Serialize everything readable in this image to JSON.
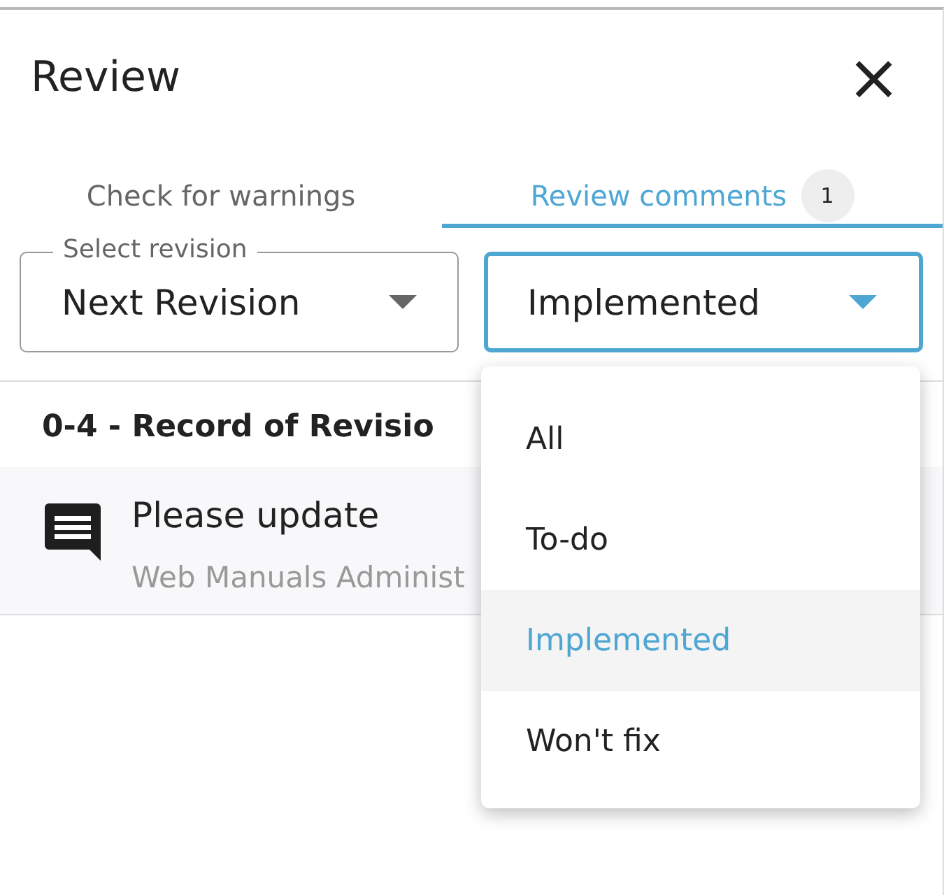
{
  "panel": {
    "title": "Review",
    "close": "×"
  },
  "tabs": [
    {
      "label": "Check for warnings",
      "selected": false
    },
    {
      "label": "Review comments",
      "selected": true,
      "badge": "1"
    }
  ],
  "revision_select": {
    "label": "Select revision",
    "value": "Next Revision"
  },
  "status_select": {
    "value": "Implemented",
    "expanded": true,
    "options": [
      {
        "label": "All",
        "selected": false
      },
      {
        "label": "To-do",
        "selected": false
      },
      {
        "label": "Implemented",
        "selected": true
      },
      {
        "label": "Won't fix",
        "selected": false
      }
    ]
  },
  "section": {
    "heading": "0-4 - Record of Revisio",
    "comments": [
      {
        "text": "Please update",
        "author": "Web Manuals Administ"
      }
    ]
  }
}
